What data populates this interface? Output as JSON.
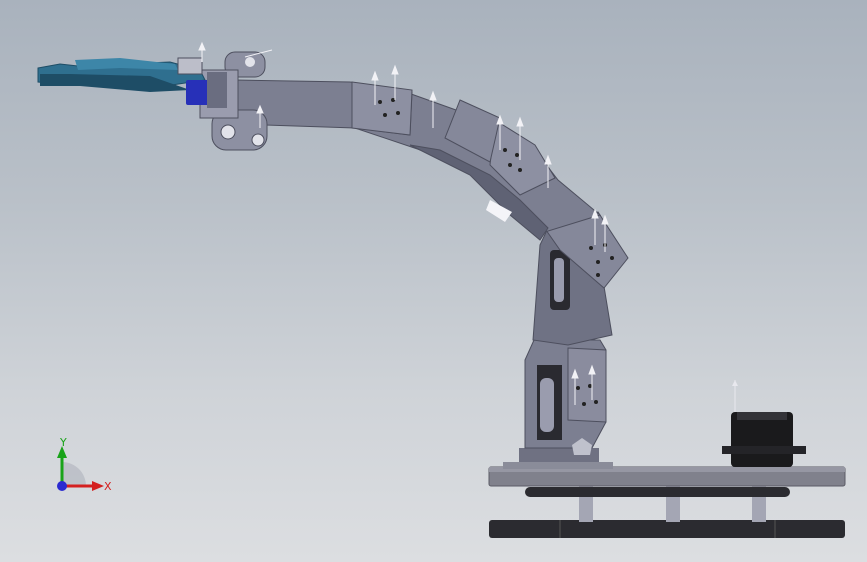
{
  "viewport": {
    "background_top": "#a9b2bd",
    "background_bottom": "#dcdee1"
  },
  "model": {
    "colors": {
      "arm_metal": "#7c7f91",
      "arm_metal_light": "#9a9cae",
      "arm_metal_dark": "#5f6274",
      "base_plate": "#80818c",
      "base_dark": "#2b2b30",
      "standoff": "#a4a6b4",
      "servo_black": "#1a1a1c",
      "gripper_blue": "#2f6f8f",
      "gripper_blue_dark": "#1e4d66",
      "accent_blue": "#2730b8"
    },
    "components": [
      {
        "icon": "gripper-icon"
      },
      {
        "icon": "wrist-joint-icon"
      },
      {
        "icon": "forearm-icon"
      },
      {
        "icon": "elbow-joint-icon"
      },
      {
        "icon": "upper-arm-icon"
      },
      {
        "icon": "shoulder-servo-icon"
      },
      {
        "icon": "base-plate-icon"
      },
      {
        "icon": "servo-motor-icon"
      }
    ]
  },
  "triad": {
    "x_label": "X",
    "y_label": "Y",
    "z_label": "",
    "x_color": "#d42020",
    "y_color": "#19a319",
    "z_color": "#2a2ad0"
  }
}
